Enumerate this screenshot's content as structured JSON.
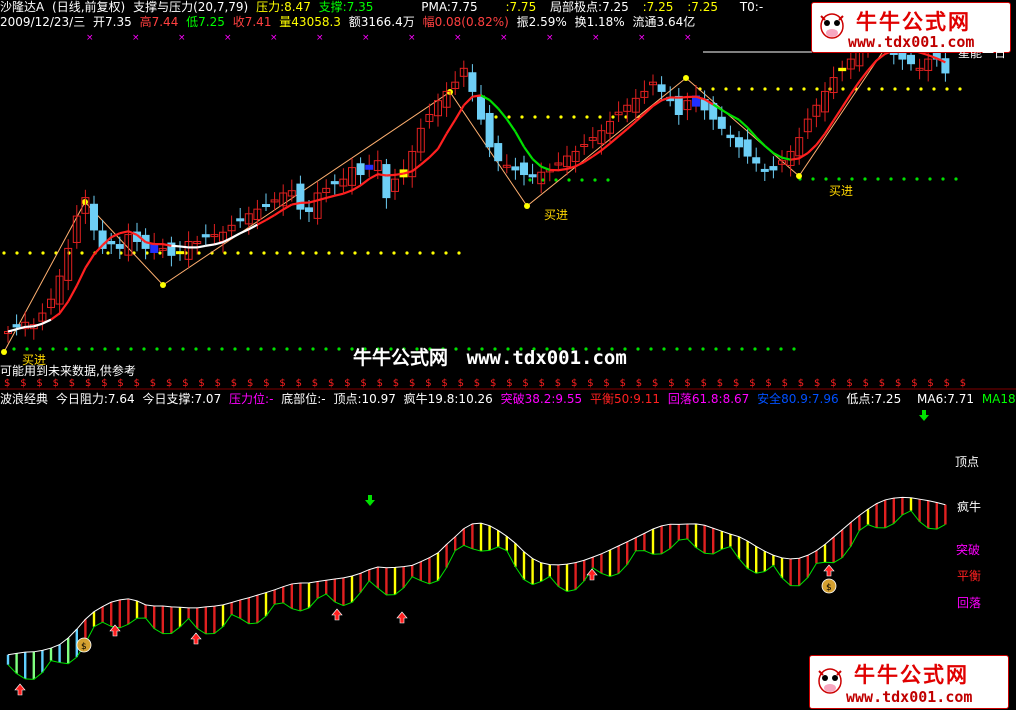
{
  "header_top": {
    "stock": "沙隆达A",
    "period": "(日线,前复权)",
    "indicator": "支撑与压力(20,7,79)",
    "pressure": "压力:8.47",
    "support": "支撑:7.35",
    "pma": "PMA:7.75",
    "pma2": ":7.75",
    "local_extreme": "局部极点:7.25",
    "v1": ":7.25",
    "v2": ":7.25",
    "t0": "T0:-"
  },
  "header_quote": {
    "date": "2009/12/23/三",
    "open": "开7.35",
    "high": "高7.44",
    "low": "低7.25",
    "close": "收7.41",
    "volume": "量43058.3",
    "amount": "额3166.4万",
    "change": "幅0.08(0.82%)",
    "amplitude": "振2.59%",
    "turnover": "换1.18%",
    "float": "流通3.64亿"
  },
  "upper_labels": {
    "right_cut": "星能一日",
    "buy_signal": "买进",
    "future_warning": "可能用到未来数据,供参考"
  },
  "watermark": {
    "text": "牛牛公式网",
    "url": "www.tdx001.com"
  },
  "logo": {
    "brand": "牛牛公式网",
    "url": "www.tdx001.com"
  },
  "header_lower": {
    "name": "波浪经典",
    "resist": "今日阻力:7.64",
    "support": "今日支撑:7.07",
    "pressure_pos": "压力位:-",
    "bottom_pos": "底部位:-",
    "top": "顶点:10.97",
    "crazy": "疯牛19.8:10.26",
    "break": "突破38.2:9.55",
    "balance": "平衡50:9.11",
    "fall": "回落61.8:8.67",
    "safe": "安全80.9:7.96",
    "low": "低点:7.25",
    "ma6": "MA6:7.71",
    "ma18": "MA18:7.9"
  },
  "lower_labels": {
    "top": "顶点",
    "crazy": "疯牛",
    "break": "突破",
    "balance": "平衡",
    "fall": "回落"
  },
  "colors": {
    "bull": "#e02020",
    "bear": "#6ecff6",
    "ma_red": "#ff2020",
    "dotted_yellow": "#ffff00",
    "dotted_green": "#00e000",
    "accent_magenta": "#ff00ff"
  },
  "chart_data": [
    {
      "type": "candlestick",
      "title": "支撑与压力(20,7,79)",
      "x": [
        1,
        2,
        3,
        4,
        5,
        6,
        7,
        8,
        9,
        10,
        11,
        12,
        13,
        14,
        15,
        16,
        17,
        18,
        19,
        20,
        21,
        22,
        23,
        24,
        25,
        26,
        27,
        28,
        29,
        30,
        31,
        32,
        33,
        34,
        35,
        36,
        37,
        38,
        39,
        40,
        41,
        42,
        43,
        44,
        45,
        46,
        47,
        48,
        49,
        50,
        51,
        52,
        53,
        54,
        55,
        56,
        57,
        58,
        59,
        60,
        61,
        62,
        63,
        64,
        65,
        66,
        67,
        68,
        69,
        70,
        71,
        72,
        73,
        74,
        75,
        76,
        77,
        78,
        79,
        80,
        81,
        82,
        83,
        84,
        85,
        86,
        87,
        88,
        89,
        90,
        91,
        92,
        93,
        94,
        95,
        96,
        97,
        98,
        99,
        100,
        101,
        102,
        103,
        104,
        105,
        106,
        107,
        108,
        109,
        110
      ],
      "close": [
        5.4,
        5.5,
        5.6,
        5.55,
        5.8,
        6.1,
        6.6,
        7.2,
        7.9,
        8.3,
        7.6,
        7.2,
        7.3,
        7.2,
        7.5,
        7.35,
        7.2,
        7.3,
        7.2,
        7.05,
        7.1,
        7.35,
        7.35,
        7.45,
        7.5,
        7.55,
        7.7,
        7.8,
        7.95,
        8.05,
        8.15,
        8.25,
        8.4,
        8.45,
        8.05,
        8.0,
        8.4,
        8.5,
        8.6,
        8.7,
        8.95,
        8.8,
        9.0,
        9.1,
        8.3,
        8.7,
        8.9,
        9.3,
        9.8,
        10.1,
        10.4,
        10.6,
        10.8,
        11.1,
        10.6,
        10.0,
        9.4,
        9.1,
        9.0,
        8.9,
        8.8,
        8.75,
        8.85,
        8.9,
        9.05,
        9.2,
        9.3,
        9.45,
        9.6,
        9.75,
        9.95,
        10.15,
        10.3,
        10.45,
        10.6,
        10.8,
        10.6,
        10.4,
        10.1,
        10.4,
        10.5,
        10.2,
        10.0,
        9.8,
        9.6,
        9.4,
        9.2,
        9.05,
        8.9,
        8.9,
        9.1,
        9.3,
        9.6,
        10.0,
        10.3,
        10.6,
        10.9,
        11.1,
        11.3,
        11.5,
        11.7,
        11.8,
        11.6,
        11.4,
        11.3,
        11.2,
        11.1,
        11.3,
        11.3,
        11.0
      ],
      "legend": "bull = red hollow, bear = cyan filled, special = blue/yellow filled"
    },
    {
      "type": "line",
      "title": "波浪经典",
      "series": [
        {
          "name": "MA6",
          "last": 7.71
        },
        {
          "name": "MA18",
          "last": 7.9
        }
      ]
    }
  ]
}
